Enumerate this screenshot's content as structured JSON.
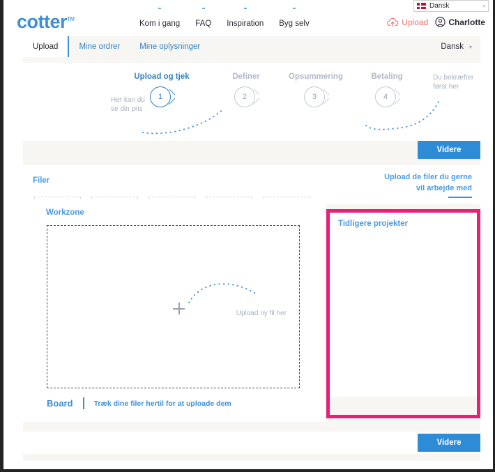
{
  "top_language_bar": {
    "flag": "danish-flag",
    "label": "Dansk",
    "caret": "▾"
  },
  "header": {
    "logo_text": "cotter",
    "logo_tm": "TM",
    "nav": [
      {
        "label": "Kom i gang"
      },
      {
        "label": "FAQ"
      },
      {
        "label": "Inspiration"
      },
      {
        "label": "Byg selv"
      }
    ],
    "upload_label": "Upload",
    "user_label": "Charlotte"
  },
  "tabbar": {
    "tabs": [
      {
        "label": "Upload",
        "active": true
      },
      {
        "label": "Mine ordrer",
        "active": false
      },
      {
        "label": "Mine oplysninger",
        "active": false
      }
    ],
    "language_label": "Dansk",
    "language_caret": "▾"
  },
  "stepper": {
    "steps": [
      {
        "number": "1",
        "label": "Upload og tjek",
        "active": true
      },
      {
        "number": "2",
        "label": "Definer",
        "active": false
      },
      {
        "number": "3",
        "label": "Opsummering",
        "active": false
      },
      {
        "number": "4",
        "label": "Betaling",
        "active": false
      }
    ],
    "hint_left": "Her kan du\nse din pris",
    "hint_right": "Du bekræfter\nførst her"
  },
  "buttons": {
    "videre_top": "Videre",
    "videre_bottom": "Videre"
  },
  "filer": {
    "title": "Filer",
    "slots": [
      {
        "has_add_icon": true
      },
      {
        "has_add_icon": false
      },
      {
        "has_add_icon": false
      },
      {
        "has_add_icon": false
      },
      {
        "has_add_icon": false
      }
    ]
  },
  "workzone": {
    "title": "Workzone",
    "dropzone_hint": "Upload ny fil her",
    "board_label": "Board",
    "board_text": "Træk dine filer hertil for at uploade dem"
  },
  "right_column": {
    "upload_note": "Upload de filer du gerne\nvil arbejde med",
    "projects_title": "Tidligere projekter"
  },
  "colors": {
    "brand_blue": "#3d8fd6",
    "link_blue": "#2f7fc4",
    "button_blue": "#2e8bd6",
    "highlight_pink": "#e91e76",
    "upload_coral": "#f2736c",
    "add_green": "#64c83c",
    "muted_gray": "#a7b0bf",
    "page_bg": "#f7f6f3"
  }
}
